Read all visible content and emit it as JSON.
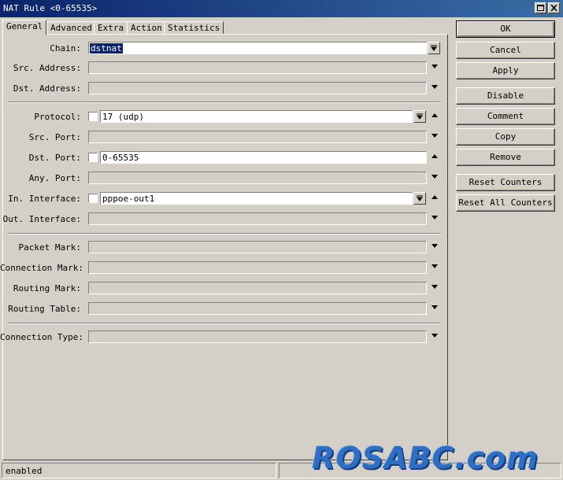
{
  "window": {
    "title": "NAT Rule <0-65535>"
  },
  "tabs": [
    "General",
    "Advanced",
    "Extra",
    "Action",
    "Statistics"
  ],
  "fields": {
    "chain": {
      "label": "Chain:",
      "value": "dstnat"
    },
    "src_address": {
      "label": "Src. Address:",
      "value": ""
    },
    "dst_address": {
      "label": "Dst. Address:",
      "value": ""
    },
    "protocol": {
      "label": "Protocol:",
      "value": "17 (udp)"
    },
    "src_port": {
      "label": "Src. Port:",
      "value": ""
    },
    "dst_port": {
      "label": "Dst. Port:",
      "value": "0-65535"
    },
    "any_port": {
      "label": "Any. Port:",
      "value": ""
    },
    "in_interface": {
      "label": "In. Interface:",
      "value": "pppoe-out1"
    },
    "out_interface": {
      "label": "Out. Interface:",
      "value": ""
    },
    "packet_mark": {
      "label": "Packet Mark:",
      "value": ""
    },
    "connection_mark": {
      "label": "Connection Mark:",
      "value": ""
    },
    "routing_mark": {
      "label": "Routing Mark:",
      "value": ""
    },
    "routing_table": {
      "label": "Routing Table:",
      "value": ""
    },
    "connection_type": {
      "label": "Connection Type:",
      "value": ""
    }
  },
  "buttons": {
    "ok": "OK",
    "cancel": "Cancel",
    "apply": "Apply",
    "disable": "Disable",
    "comment": "Comment",
    "copy": "Copy",
    "remove": "Remove",
    "reset_counters": "Reset Counters",
    "reset_all_counters": "Reset All Counters"
  },
  "status": {
    "text": "enabled"
  },
  "watermark": "ROSABC.com",
  "icons": {
    "minimize": "restore-icon",
    "close": "close-icon",
    "dropdown": "dropdown-arrow-icon",
    "collapse": "up-arrow-icon"
  },
  "colors": {
    "titlebar": "#0a246a",
    "face": "#d4d0c8",
    "selection": "#0a246a"
  }
}
